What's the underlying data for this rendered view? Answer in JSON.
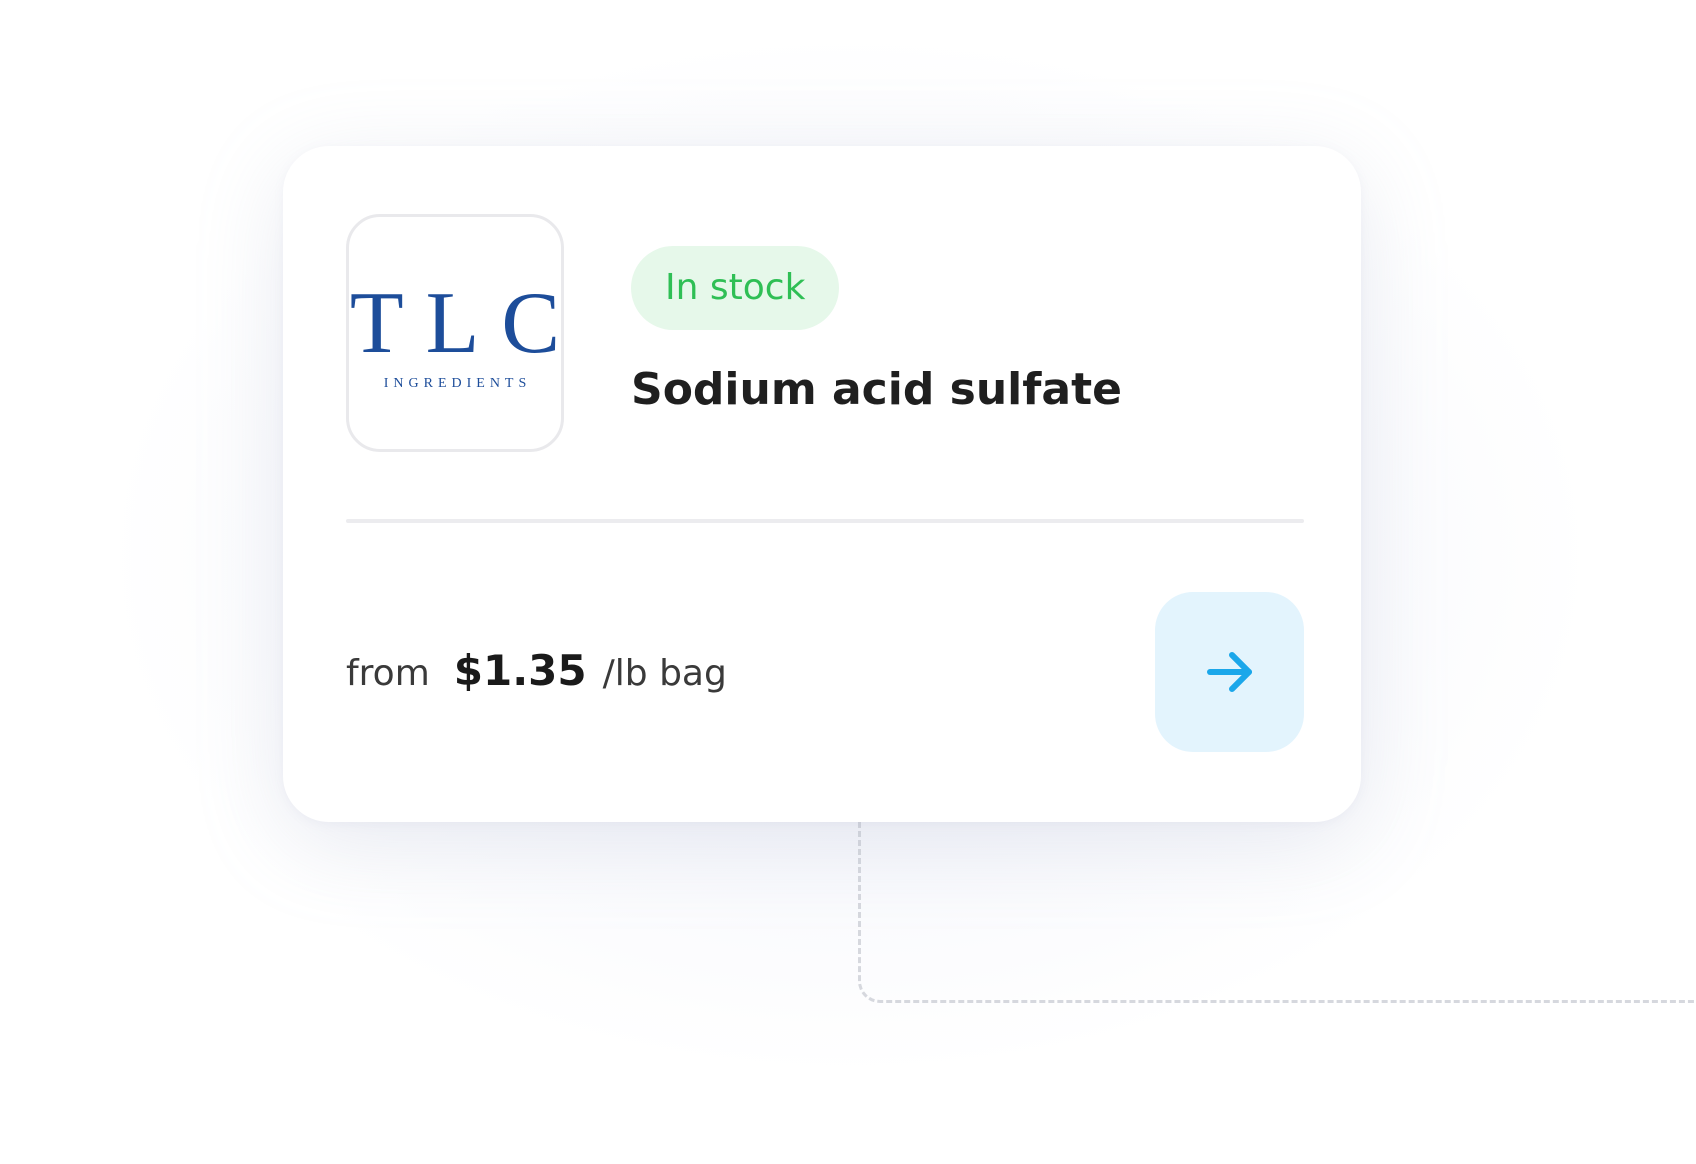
{
  "product": {
    "stock_status": "In stock",
    "name": "Sodium acid sulfate",
    "price_prefix": "from",
    "price": "$1.35",
    "price_unit": "/lb bag"
  },
  "supplier_logo": {
    "main_text": "TLC",
    "sub_text": "INGREDIENTS",
    "color": "#1d4d9a"
  },
  "colors": {
    "badge_bg": "#e6f8ea",
    "badge_text": "#2fbf55",
    "button_bg": "#e3f4fd",
    "button_icon": "#1ba7ea"
  },
  "icons": {
    "action": "arrow-right-icon"
  }
}
